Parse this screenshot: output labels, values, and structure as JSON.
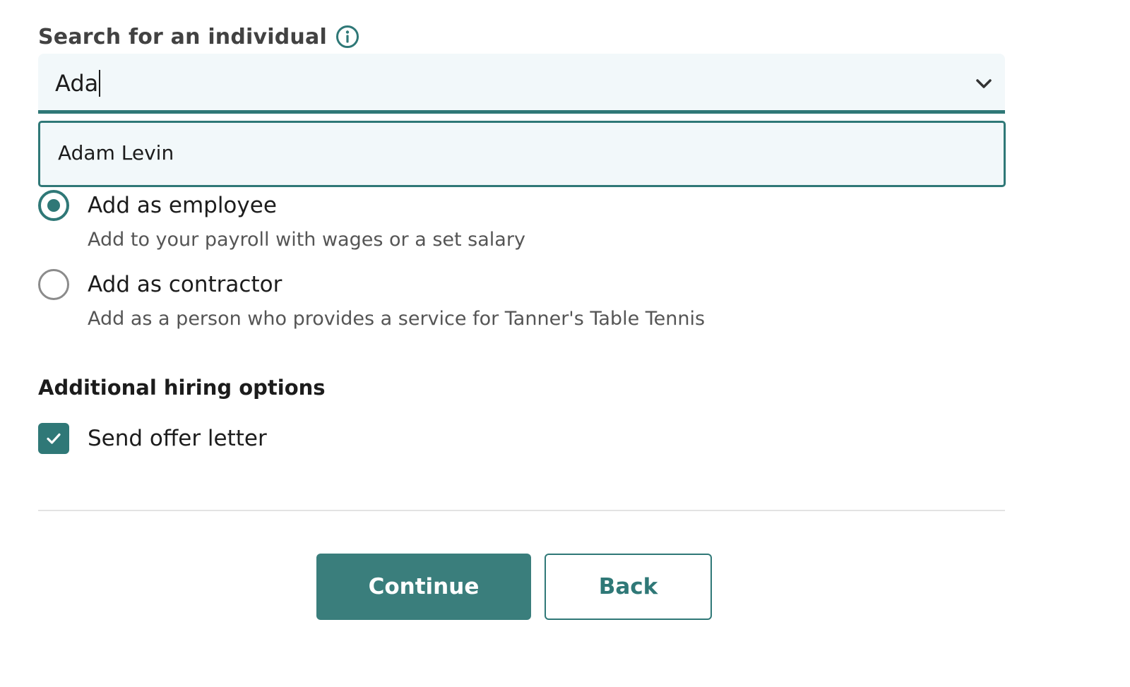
{
  "search": {
    "label": "Search for an individual",
    "value": "Ada",
    "suggestions": [
      "Adam Levin"
    ]
  },
  "hire_type": {
    "options": [
      {
        "title": "Add as employee",
        "description": "Add to your payroll with wages or a set salary",
        "selected": true
      },
      {
        "title": "Add as contractor",
        "description": "Add as a person who provides a service for Tanner's Table Tennis",
        "selected": false
      }
    ]
  },
  "additional": {
    "heading": "Additional hiring options",
    "send_offer_letter": {
      "label": "Send offer letter",
      "checked": true
    }
  },
  "actions": {
    "continue_label": "Continue",
    "back_label": "Back"
  },
  "colors": {
    "accent": "#2f7877",
    "button_fill": "#3a7e7c",
    "field_background": "#f2f8fa"
  },
  "icons": {
    "info": "info-icon",
    "dropdown": "chevron-down-icon",
    "check": "check-icon"
  }
}
